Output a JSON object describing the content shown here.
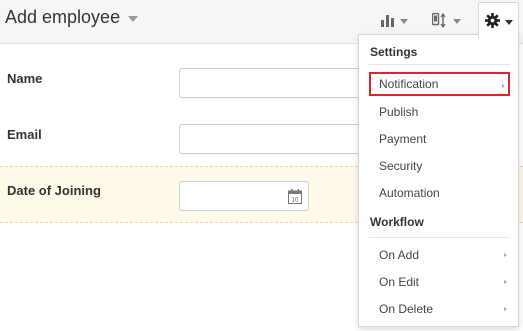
{
  "header": {
    "title": "Add employee",
    "toolbar_icons": [
      "bar-chart-icon",
      "mobile-sort-icon",
      "gear-icon"
    ]
  },
  "form": {
    "fields": [
      {
        "label": "Name",
        "value": ""
      },
      {
        "label": "Email",
        "value": ""
      },
      {
        "label": "Date of Joining",
        "value": "",
        "calendar_day": "10"
      }
    ]
  },
  "settings_menu": {
    "sections": [
      {
        "heading": "Settings",
        "items": [
          {
            "label": "Notification",
            "has_submenu": true,
            "highlighted": true
          },
          {
            "label": "Publish",
            "has_submenu": false
          },
          {
            "label": "Payment",
            "has_submenu": false
          },
          {
            "label": "Security",
            "has_submenu": false
          },
          {
            "label": "Automation",
            "has_submenu": false
          }
        ]
      },
      {
        "heading": "Workflow",
        "items": [
          {
            "label": "On Add",
            "has_submenu": true
          },
          {
            "label": "On Edit",
            "has_submenu": true
          },
          {
            "label": "On Delete",
            "has_submenu": true
          }
        ]
      }
    ]
  },
  "colors": {
    "highlight_border": "#e0242f",
    "doj_row_background": "#fff9ea"
  }
}
